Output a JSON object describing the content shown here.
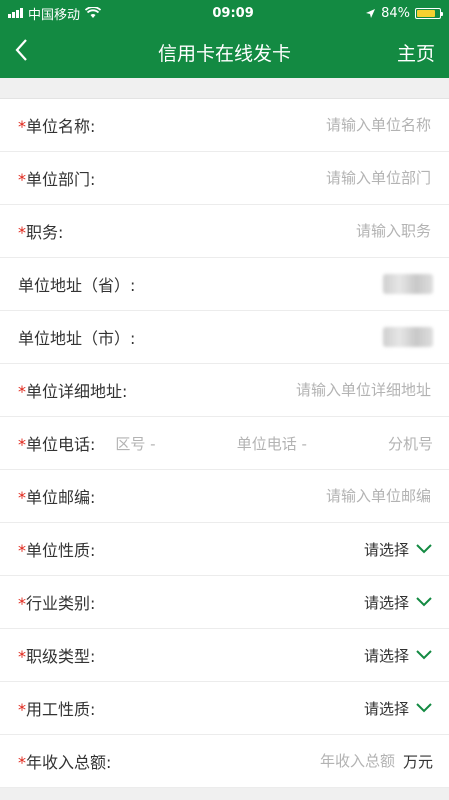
{
  "status_bar": {
    "carrier": "中国移动",
    "time": "09:09",
    "battery": "84%",
    "battery_level": 0.84
  },
  "nav": {
    "back_icon": "chevron-left-icon",
    "title": "信用卡在线发卡",
    "home_label": "主页"
  },
  "form": {
    "required_mark": "*",
    "company_name": {
      "label": "单位名称:",
      "placeholder": "请输入单位名称"
    },
    "department": {
      "label": "单位部门:",
      "placeholder": "请输入单位部门"
    },
    "position": {
      "label": "职务:",
      "placeholder": "请输入职务"
    },
    "address_province": {
      "label": "单位地址（省）:"
    },
    "address_city": {
      "label": "单位地址（市）:"
    },
    "address_detail": {
      "label": "单位详细地址:",
      "placeholder": "请输入单位详细地址"
    },
    "phone": {
      "label": "单位电话:",
      "area_code": "区号 -",
      "number": "单位电话 -",
      "extension": "分机号"
    },
    "postcode": {
      "label": "单位邮编:",
      "placeholder": "请输入单位邮编"
    },
    "company_nature": {
      "label": "单位性质:",
      "value": "请选择"
    },
    "industry": {
      "label": "行业类别:",
      "value": "请选择"
    },
    "job_level": {
      "label": "职级类型:",
      "value": "请选择"
    },
    "employment_type": {
      "label": "用工性质:",
      "value": "请选择"
    },
    "annual_income": {
      "label": "年收入总额:",
      "placeholder": "年收入总额",
      "unit": "万元"
    }
  },
  "colors": {
    "primary": "#138a42",
    "required": "#e0261a",
    "placeholder": "#b3b3b3"
  }
}
